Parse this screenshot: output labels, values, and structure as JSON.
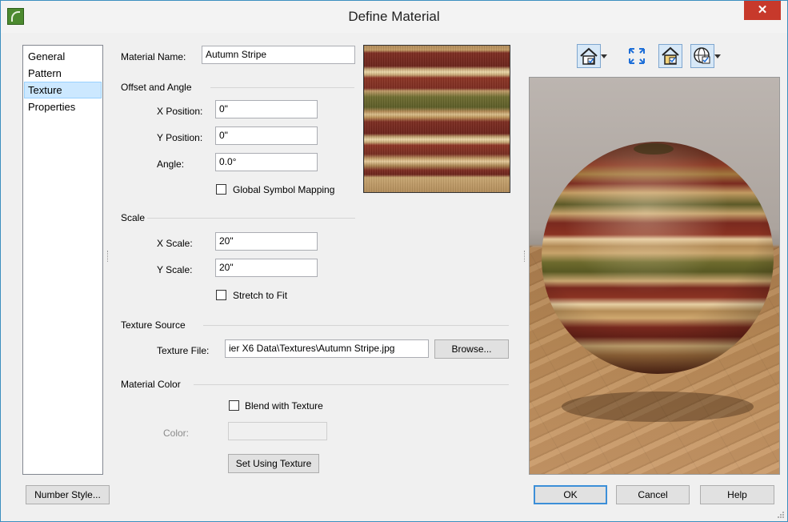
{
  "window": {
    "title": "Define Material",
    "close_glyph": "✕"
  },
  "nav": {
    "items": [
      "General",
      "Pattern",
      "Texture",
      "Properties"
    ],
    "selected": "Texture"
  },
  "material_name": {
    "label": "Material Name:",
    "value": "Autumn Stripe"
  },
  "offset_angle": {
    "heading": "Offset and Angle",
    "x_position": {
      "label": "X Position:",
      "value": "0\""
    },
    "y_position": {
      "label": "Y Position:",
      "value": "0\""
    },
    "angle": {
      "label": "Angle:",
      "value": "0.0°"
    },
    "global_symbol_mapping": {
      "label": "Global Symbol Mapping",
      "checked": false
    }
  },
  "scale": {
    "heading": "Scale",
    "x_scale": {
      "label": "X Scale:",
      "value": "20\""
    },
    "y_scale": {
      "label": "Y Scale:",
      "value": "20\""
    },
    "stretch_to_fit": {
      "label": "Stretch to Fit",
      "checked": false
    }
  },
  "texture_source": {
    "heading": "Texture Source",
    "file_label": "Texture File:",
    "file_value": "ier X6 Data\\Textures\\Autumn Stripe.jpg",
    "browse_label": "Browse..."
  },
  "material_color": {
    "heading": "Material Color",
    "blend_label": "Blend with Texture",
    "blend_checked": false,
    "color_label": "Color:",
    "color_value": "",
    "set_using_texture_label": "Set Using Texture"
  },
  "toolbar": {
    "icons": [
      "room-view-icon",
      "fullscreen-icon",
      "material-preview-icon",
      "globe-view-icon"
    ]
  },
  "footer": {
    "number_style_label": "Number Style...",
    "ok_label": "OK",
    "cancel_label": "Cancel",
    "help_label": "Help"
  }
}
